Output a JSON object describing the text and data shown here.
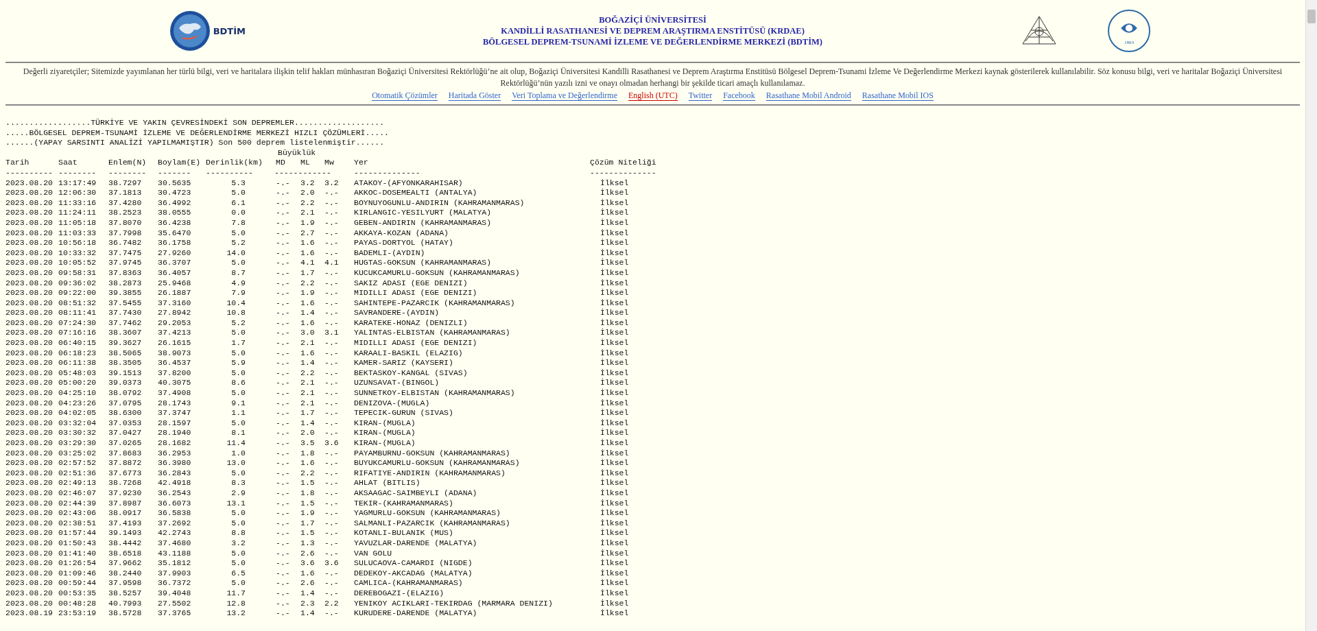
{
  "header": {
    "logo_text": "BDTİM",
    "seal_year": "1863",
    "title_lines": [
      "BOĞAZİÇİ ÜNİVERSİTESİ",
      "KANDİLLİ RASATHANESİ VE DEPREM ARAŞTIRMA ENSTİTÜSÜ (KRDAE)",
      "BÖLGESEL DEPREM-TSUNAMİ İZLEME VE DEĞERLENDİRME MERKEZİ (BDTİM)"
    ]
  },
  "notice": "Değerli ziyaretçiler; Sitemizde yayımlanan her türlü bilgi, veri ve haritalara ilişkin telif hakları münhasıran Boğaziçi Üniversitesi Rektörlüğü’ne ait olup, Boğaziçi Üniversitesi Kandilli Rasathanesi ve Deprem Araştırma Enstitüsü Bölgesel Deprem-Tsunami İzleme Ve Değerlendirme Merkezi kaynak gösterilerek kullanılabilir. Söz konusu bilgi, veri ve haritalar Boğaziçi Üniversitesi Rektörlüğü’nün yazılı izni ve onayı olmadan herhangi bir şekilde ticari amaçlı kullanılamaz.",
  "links": [
    {
      "label": "Otomatik Çözümler",
      "color": "#3366cc"
    },
    {
      "label": "Haritada Göster",
      "color": "#3366cc"
    },
    {
      "label": "Veri Toplama ve Değerlendirme",
      "color": "#3366cc"
    },
    {
      "label": "English (UTC)",
      "color": "#cc0000"
    },
    {
      "label": "Twitter",
      "color": "#3366cc"
    },
    {
      "label": "Facebook",
      "color": "#3366cc"
    },
    {
      "label": "Rasathane Mobil Android",
      "color": "#3366cc"
    },
    {
      "label": "Rasathane Mobil IOS",
      "color": "#3366cc"
    }
  ],
  "listing": {
    "intro_lines": [
      "..................TÜRKİYE VE YAKIN ÇEVRESİNDEKİ SON DEPREMLER...................",
      ".....BÖLGESEL DEPREM-TSUNAMİ İZLEME VE DEĞERLENDİRME MERKEZİ HIZLI ÇÖZÜMLERİ.....",
      "......(YAPAY SARSINTI ANALİZİ YAPILMAMIŞTIR) Son 500 deprem listelenmiştir......"
    ],
    "magnitude_heading": "Büyüklük",
    "columns": [
      "Tarih",
      "Saat",
      "Enlem(N)",
      "Boylam(E)",
      "Derinlik(km)",
      "MD",
      "ML",
      "Mw",
      "Yer",
      "Çözüm Niteliği"
    ],
    "separators": [
      "----------",
      "--------",
      "--------",
      "-------",
      "----------",
      "------------",
      "--------------",
      "--------------"
    ],
    "rows": [
      {
        "date": "2023.08.20",
        "time": "13:17:49",
        "lat": "38.7297",
        "lon": "30.5635",
        "depth": "5.3",
        "md": "-.-",
        "ml": "3.2",
        "mw": "3.2",
        "place": "ATAKOY-(AFYONKARAHISAR)",
        "quality": "İlksel"
      },
      {
        "date": "2023.08.20",
        "time": "12:06:30",
        "lat": "37.1813",
        "lon": "30.4723",
        "depth": "5.0",
        "md": "-.-",
        "ml": "2.0",
        "mw": "-.-",
        "place": "AKKOC-DOSEMEALTI (ANTALYA)",
        "quality": "İlksel"
      },
      {
        "date": "2023.08.20",
        "time": "11:33:16",
        "lat": "37.4280",
        "lon": "36.4992",
        "depth": "6.1",
        "md": "-.-",
        "ml": "2.2",
        "mw": "-.-",
        "place": "BOYNUYOGUNLU-ANDIRIN (KAHRAMANMARAS)",
        "quality": "İlksel"
      },
      {
        "date": "2023.08.20",
        "time": "11:24:11",
        "lat": "38.2523",
        "lon": "38.0555",
        "depth": "0.0",
        "md": "-.-",
        "ml": "2.1",
        "mw": "-.-",
        "place": "KIRLANGIC-YESILYURT (MALATYA)",
        "quality": "İlksel"
      },
      {
        "date": "2023.08.20",
        "time": "11:05:18",
        "lat": "37.8070",
        "lon": "36.4238",
        "depth": "7.8",
        "md": "-.-",
        "ml": "1.9",
        "mw": "-.-",
        "place": "GEBEN-ANDIRIN (KAHRAMANMARAS)",
        "quality": "İlksel"
      },
      {
        "date": "2023.08.20",
        "time": "11:03:33",
        "lat": "37.7998",
        "lon": "35.6470",
        "depth": "5.0",
        "md": "-.-",
        "ml": "2.7",
        "mw": "-.-",
        "place": "AKKAYA-KOZAN (ADANA)",
        "quality": "İlksel"
      },
      {
        "date": "2023.08.20",
        "time": "10:56:18",
        "lat": "36.7482",
        "lon": "36.1758",
        "depth": "5.2",
        "md": "-.-",
        "ml": "1.6",
        "mw": "-.-",
        "place": "PAYAS-DORTYOL (HATAY)",
        "quality": "İlksel"
      },
      {
        "date": "2023.08.20",
        "time": "10:33:32",
        "lat": "37.7475",
        "lon": "27.9260",
        "depth": "14.0",
        "md": "-.-",
        "ml": "1.6",
        "mw": "-.-",
        "place": "BADEMLI-(AYDIN)",
        "quality": "İlksel"
      },
      {
        "date": "2023.08.20",
        "time": "10:05:52",
        "lat": "37.9745",
        "lon": "36.3707",
        "depth": "5.0",
        "md": "-.-",
        "ml": "4.1",
        "mw": "4.1",
        "place": "HUGTAS-GOKSUN (KAHRAMANMARAS)",
        "quality": "İlksel"
      },
      {
        "date": "2023.08.20",
        "time": "09:58:31",
        "lat": "37.8363",
        "lon": "36.4057",
        "depth": "8.7",
        "md": "-.-",
        "ml": "1.7",
        "mw": "-.-",
        "place": "KUCUKCAMURLU-GOKSUN (KAHRAMANMARAS)",
        "quality": "İlksel"
      },
      {
        "date": "2023.08.20",
        "time": "09:36:02",
        "lat": "38.2873",
        "lon": "25.9468",
        "depth": "4.9",
        "md": "-.-",
        "ml": "2.2",
        "mw": "-.-",
        "place": "SAKIZ ADASI (EGE DENIZI)",
        "quality": "İlksel"
      },
      {
        "date": "2023.08.20",
        "time": "09:22:00",
        "lat": "39.3855",
        "lon": "26.1887",
        "depth": "7.9",
        "md": "-.-",
        "ml": "1.9",
        "mw": "-.-",
        "place": "MIDILLI ADASI (EGE DENIZI)",
        "quality": "İlksel"
      },
      {
        "date": "2023.08.20",
        "time": "08:51:32",
        "lat": "37.5455",
        "lon": "37.3160",
        "depth": "10.4",
        "md": "-.-",
        "ml": "1.6",
        "mw": "-.-",
        "place": "SAHINTEPE-PAZARCIK (KAHRAMANMARAS)",
        "quality": "İlksel"
      },
      {
        "date": "2023.08.20",
        "time": "08:11:41",
        "lat": "37.7430",
        "lon": "27.8942",
        "depth": "10.8",
        "md": "-.-",
        "ml": "1.4",
        "mw": "-.-",
        "place": "SAVRANDERE-(AYDIN)",
        "quality": "İlksel"
      },
      {
        "date": "2023.08.20",
        "time": "07:24:30",
        "lat": "37.7462",
        "lon": "29.2053",
        "depth": "5.2",
        "md": "-.-",
        "ml": "1.6",
        "mw": "-.-",
        "place": "KARATEKE-HONAZ (DENIZLI)",
        "quality": "İlksel"
      },
      {
        "date": "2023.08.20",
        "time": "07:16:16",
        "lat": "38.3607",
        "lon": "37.4213",
        "depth": "5.0",
        "md": "-.-",
        "ml": "3.0",
        "mw": "3.1",
        "place": "YALINTAS-ELBISTAN (KAHRAMANMARAS)",
        "quality": "İlksel"
      },
      {
        "date": "2023.08.20",
        "time": "06:40:15",
        "lat": "39.3627",
        "lon": "26.1615",
        "depth": "1.7",
        "md": "-.-",
        "ml": "2.1",
        "mw": "-.-",
        "place": "MIDILLI ADASI (EGE DENIZI)",
        "quality": "İlksel"
      },
      {
        "date": "2023.08.20",
        "time": "06:18:23",
        "lat": "38.5065",
        "lon": "38.9073",
        "depth": "5.0",
        "md": "-.-",
        "ml": "1.6",
        "mw": "-.-",
        "place": "KARAALI-BASKIL (ELAZIG)",
        "quality": "İlksel"
      },
      {
        "date": "2023.08.20",
        "time": "06:11:38",
        "lat": "38.3505",
        "lon": "36.4537",
        "depth": "5.9",
        "md": "-.-",
        "ml": "1.4",
        "mw": "-.-",
        "place": "KAMER-SARIZ (KAYSERI)",
        "quality": "İlksel"
      },
      {
        "date": "2023.08.20",
        "time": "05:48:03",
        "lat": "39.1513",
        "lon": "37.8200",
        "depth": "5.0",
        "md": "-.-",
        "ml": "2.2",
        "mw": "-.-",
        "place": "BEKTASKOY-KANGAL (SIVAS)",
        "quality": "İlksel"
      },
      {
        "date": "2023.08.20",
        "time": "05:00:20",
        "lat": "39.0373",
        "lon": "40.3075",
        "depth": "8.6",
        "md": "-.-",
        "ml": "2.1",
        "mw": "-.-",
        "place": "UZUNSAVAT-(BINGOL)",
        "quality": "İlksel"
      },
      {
        "date": "2023.08.20",
        "time": "04:25:10",
        "lat": "38.0792",
        "lon": "37.4908",
        "depth": "5.0",
        "md": "-.-",
        "ml": "2.1",
        "mw": "-.-",
        "place": "SUNNETKOY-ELBISTAN (KAHRAMANMARAS)",
        "quality": "İlksel"
      },
      {
        "date": "2023.08.20",
        "time": "04:23:26",
        "lat": "37.0795",
        "lon": "28.1743",
        "depth": "9.1",
        "md": "-.-",
        "ml": "2.1",
        "mw": "-.-",
        "place": "DENIZOVA-(MUGLA)",
        "quality": "İlksel"
      },
      {
        "date": "2023.08.20",
        "time": "04:02:05",
        "lat": "38.6300",
        "lon": "37.3747",
        "depth": "1.1",
        "md": "-.-",
        "ml": "1.7",
        "mw": "-.-",
        "place": "TEPECIK-GURUN (SIVAS)",
        "quality": "İlksel"
      },
      {
        "date": "2023.08.20",
        "time": "03:32:04",
        "lat": "37.0353",
        "lon": "28.1597",
        "depth": "5.0",
        "md": "-.-",
        "ml": "1.4",
        "mw": "-.-",
        "place": "KIRAN-(MUGLA)",
        "quality": "İlksel"
      },
      {
        "date": "2023.08.20",
        "time": "03:30:32",
        "lat": "37.0427",
        "lon": "28.1940",
        "depth": "8.1",
        "md": "-.-",
        "ml": "2.0",
        "mw": "-.-",
        "place": "KIRAN-(MUGLA)",
        "quality": "İlksel"
      },
      {
        "date": "2023.08.20",
        "time": "03:29:30",
        "lat": "37.0265",
        "lon": "28.1682",
        "depth": "11.4",
        "md": "-.-",
        "ml": "3.5",
        "mw": "3.6",
        "place": "KIRAN-(MUGLA)",
        "quality": "İlksel"
      },
      {
        "date": "2023.08.20",
        "time": "03:25:02",
        "lat": "37.8683",
        "lon": "36.2953",
        "depth": "1.0",
        "md": "-.-",
        "ml": "1.8",
        "mw": "-.-",
        "place": "PAYAMBURNU-GOKSUN (KAHRAMANMARAS)",
        "quality": "İlksel"
      },
      {
        "date": "2023.08.20",
        "time": "02:57:52",
        "lat": "37.8872",
        "lon": "36.3980",
        "depth": "13.0",
        "md": "-.-",
        "ml": "1.6",
        "mw": "-.-",
        "place": "BUYUKCAMURLU-GOKSUN (KAHRAMANMARAS)",
        "quality": "İlksel"
      },
      {
        "date": "2023.08.20",
        "time": "02:51:36",
        "lat": "37.6773",
        "lon": "36.2843",
        "depth": "5.0",
        "md": "-.-",
        "ml": "2.2",
        "mw": "-.-",
        "place": "RIFATIYE-ANDIRIN (KAHRAMANMARAS)",
        "quality": "İlksel"
      },
      {
        "date": "2023.08.20",
        "time": "02:49:13",
        "lat": "38.7268",
        "lon": "42.4918",
        "depth": "8.3",
        "md": "-.-",
        "ml": "1.5",
        "mw": "-.-",
        "place": "AHLAT (BITLIS)",
        "quality": "İlksel"
      },
      {
        "date": "2023.08.20",
        "time": "02:46:07",
        "lat": "37.9230",
        "lon": "36.2543",
        "depth": "2.9",
        "md": "-.-",
        "ml": "1.8",
        "mw": "-.-",
        "place": "AKSAAGAC-SAIMBEYLI (ADANA)",
        "quality": "İlksel"
      },
      {
        "date": "2023.08.20",
        "time": "02:44:39",
        "lat": "37.8987",
        "lon": "36.6073",
        "depth": "13.1",
        "md": "-.-",
        "ml": "1.5",
        "mw": "-.-",
        "place": "TEKIR-(KAHRAMANMARAS)",
        "quality": "İlksel"
      },
      {
        "date": "2023.08.20",
        "time": "02:43:06",
        "lat": "38.0917",
        "lon": "36.5838",
        "depth": "5.0",
        "md": "-.-",
        "ml": "1.9",
        "mw": "-.-",
        "place": "YAGMURLU-GOKSUN (KAHRAMANMARAS)",
        "quality": "İlksel"
      },
      {
        "date": "2023.08.20",
        "time": "02:38:51",
        "lat": "37.4193",
        "lon": "37.2692",
        "depth": "5.0",
        "md": "-.-",
        "ml": "1.7",
        "mw": "-.-",
        "place": "SALMANLI-PAZARCIK (KAHRAMANMARAS)",
        "quality": "İlksel"
      },
      {
        "date": "2023.08.20",
        "time": "01:57:44",
        "lat": "39.1493",
        "lon": "42.2743",
        "depth": "8.8",
        "md": "-.-",
        "ml": "1.5",
        "mw": "-.-",
        "place": "KOTANLI-BULANIK (MUS)",
        "quality": "İlksel"
      },
      {
        "date": "2023.08.20",
        "time": "01:50:43",
        "lat": "38.4442",
        "lon": "37.4680",
        "depth": "3.2",
        "md": "-.-",
        "ml": "1.3",
        "mw": "-.-",
        "place": "YAVUZLAR-DARENDE (MALATYA)",
        "quality": "İlksel"
      },
      {
        "date": "2023.08.20",
        "time": "01:41:40",
        "lat": "38.6518",
        "lon": "43.1188",
        "depth": "5.0",
        "md": "-.-",
        "ml": "2.6",
        "mw": "-.-",
        "place": "VAN GOLU",
        "quality": "İlksel"
      },
      {
        "date": "2023.08.20",
        "time": "01:26:54",
        "lat": "37.9662",
        "lon": "35.1812",
        "depth": "5.0",
        "md": "-.-",
        "ml": "3.6",
        "mw": "3.6",
        "place": "SULUCAOVA-CAMARDI (NIGDE)",
        "quality": "İlksel"
      },
      {
        "date": "2023.08.20",
        "time": "01:09:46",
        "lat": "38.2440",
        "lon": "37.9903",
        "depth": "6.5",
        "md": "-.-",
        "ml": "1.6",
        "mw": "-.-",
        "place": "DEDEKOY-AKCADAG (MALATYA)",
        "quality": "İlksel"
      },
      {
        "date": "2023.08.20",
        "time": "00:59:44",
        "lat": "37.9598",
        "lon": "36.7372",
        "depth": "5.0",
        "md": "-.-",
        "ml": "2.6",
        "mw": "-.-",
        "place": "CAMLICA-(KAHRAMANMARAS)",
        "quality": "İlksel"
      },
      {
        "date": "2023.08.20",
        "time": "00:53:35",
        "lat": "38.5257",
        "lon": "39.4048",
        "depth": "11.7",
        "md": "-.-",
        "ml": "1.4",
        "mw": "-.-",
        "place": "DEREBOGAZI-(ELAZIG)",
        "quality": "İlksel"
      },
      {
        "date": "2023.08.20",
        "time": "00:48:28",
        "lat": "40.7993",
        "lon": "27.5502",
        "depth": "12.8",
        "md": "-.-",
        "ml": "2.3",
        "mw": "2.2",
        "place": "YENIKOY ACIKLARI-TEKIRDAG (MARMARA DENIZI)",
        "quality": "İlksel"
      },
      {
        "date": "2023.08.19",
        "time": "23:53:19",
        "lat": "38.5728",
        "lon": "37.3765",
        "depth": "13.2",
        "md": "-.-",
        "ml": "1.4",
        "mw": "-.-",
        "place": "KURUDERE-DARENDE (MALATYA)",
        "quality": "İlksel"
      }
    ]
  }
}
